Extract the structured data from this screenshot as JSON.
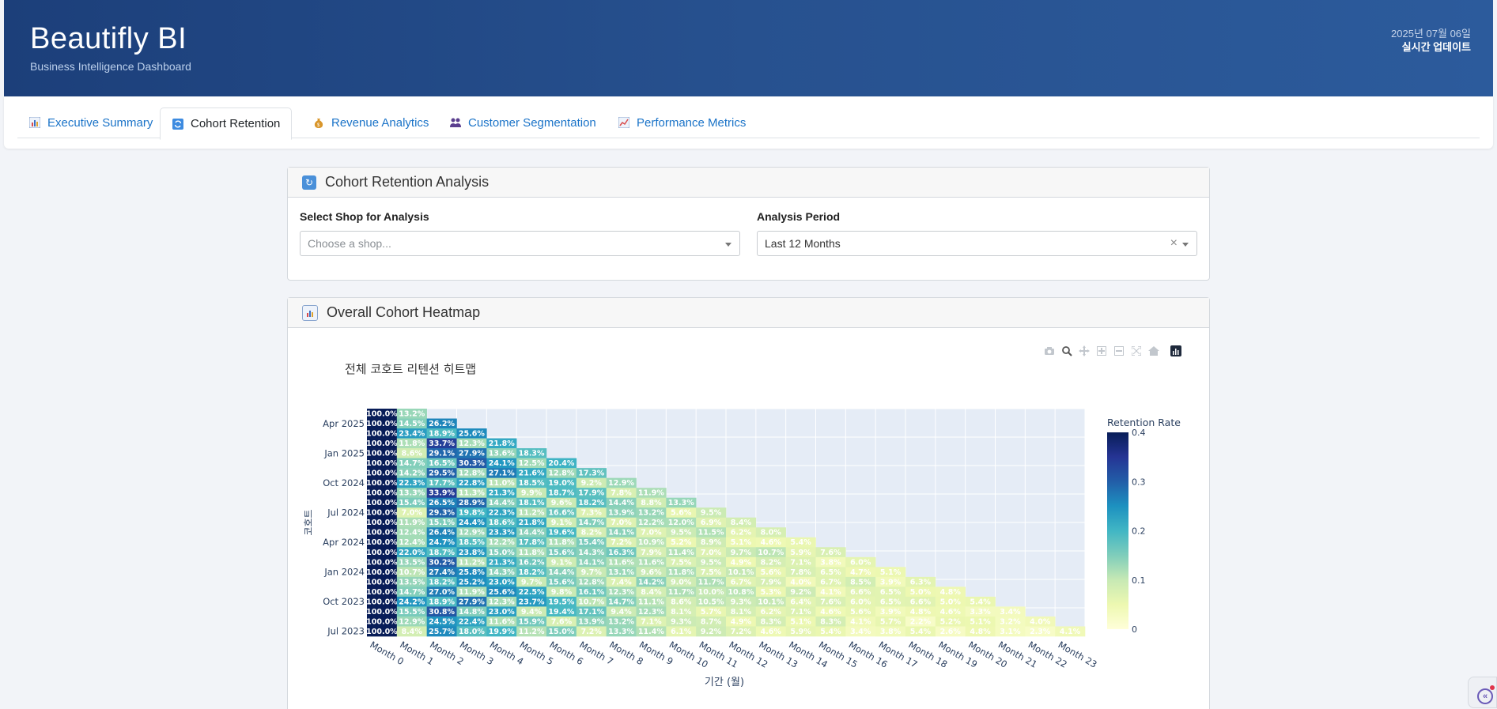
{
  "header": {
    "title": "Beautifly BI",
    "subtitle": "Business Intelligence Dashboard",
    "date": "2025년 07월 06일",
    "live": "실시간 업데이트"
  },
  "tabs": [
    {
      "label": "Executive Summary",
      "icon": "bar-chart-icon",
      "active": false
    },
    {
      "label": "Cohort Retention",
      "icon": "refresh-icon",
      "active": true
    },
    {
      "label": "Revenue Analytics",
      "icon": "money-bag-icon",
      "active": false
    },
    {
      "label": "Customer Segmentation",
      "icon": "people-icon",
      "active": false
    },
    {
      "label": "Performance Metrics",
      "icon": "line-chart-icon",
      "active": false
    }
  ],
  "cohort_panel": {
    "title": "Cohort Retention Analysis",
    "shop_label": "Select Shop for Analysis",
    "shop_placeholder": "Choose a shop...",
    "period_label": "Analysis Period",
    "period_value": "Last 12 Months"
  },
  "heatmap_panel": {
    "title": "Overall Cohort Heatmap"
  },
  "modebar": [
    "camera-icon",
    "zoom-icon",
    "pan-icon",
    "zoom-in-icon",
    "zoom-out-icon",
    "autoscale-icon",
    "reset-axes-icon",
    "plotly-logo-icon"
  ],
  "chart_data": {
    "type": "heatmap",
    "title": "전체 코호트 리텐션 히트맵",
    "xlabel": "기간 (월)",
    "ylabel": "코호트",
    "colorbar_title": "Retention Rate",
    "colorbar_ticks": [
      "0.4",
      "0.3",
      "0.2",
      "0.1",
      "0"
    ],
    "zmin": 0,
    "zmax": 0.4,
    "colorscale": [
      "#ffffd9",
      "#edf8b1",
      "#c7e9b4",
      "#7fcdbb",
      "#41b6c4",
      "#1d91c0",
      "#225ea8",
      "#253494",
      "#081d58"
    ],
    "x": [
      "Month 0",
      "Month 1",
      "Month 2",
      "Month 3",
      "Month 4",
      "Month 5",
      "Month 6",
      "Month 7",
      "Month 8",
      "Month 9",
      "Month 10",
      "Month 11",
      "Month 12",
      "Month 13",
      "Month 14",
      "Month 15",
      "Month 16",
      "Month 17",
      "Month 18",
      "Month 19",
      "Month 20",
      "Month 21",
      "Month 22",
      "Month 23"
    ],
    "y_ticks": [
      "Apr 2025",
      "Jan 2025",
      "Oct 2024",
      "Jul 2024",
      "Apr 2024",
      "Jan 2024",
      "Oct 2023",
      "Jul 2023"
    ],
    "cohorts": [
      [
        "100.0%",
        "13.2%"
      ],
      [
        "100.0%",
        "14.5%",
        "26.2%"
      ],
      [
        "100.0%",
        "23.4%",
        "18.9%",
        "25.6%"
      ],
      [
        "100.0%",
        "11.8%",
        "33.7%",
        "12.3%",
        "21.8%"
      ],
      [
        "100.0%",
        "8.6%",
        "29.1%",
        "27.9%",
        "13.6%",
        "18.3%"
      ],
      [
        "100.0%",
        "14.7%",
        "16.5%",
        "30.3%",
        "24.1%",
        "12.5%",
        "20.4%"
      ],
      [
        "100.0%",
        "14.2%",
        "29.5%",
        "12.8%",
        "27.1%",
        "21.6%",
        "12.8%",
        "17.3%"
      ],
      [
        "100.0%",
        "22.3%",
        "17.7%",
        "22.8%",
        "11.0%",
        "18.5%",
        "19.0%",
        "9.2%",
        "12.9%"
      ],
      [
        "100.0%",
        "13.3%",
        "33.9%",
        "11.3%",
        "21.3%",
        "9.9%",
        "18.7%",
        "17.9%",
        "7.8%",
        "11.9%"
      ],
      [
        "100.0%",
        "15.4%",
        "26.5%",
        "28.9%",
        "14.4%",
        "18.1%",
        "9.6%",
        "18.2%",
        "14.4%",
        "8.8%",
        "13.3%"
      ],
      [
        "100.0%",
        "7.0%",
        "29.3%",
        "19.8%",
        "22.3%",
        "11.2%",
        "16.6%",
        "7.3%",
        "13.9%",
        "13.2%",
        "5.6%",
        "9.5%"
      ],
      [
        "100.0%",
        "11.9%",
        "15.1%",
        "24.4%",
        "18.6%",
        "21.8%",
        "9.1%",
        "14.7%",
        "7.0%",
        "12.2%",
        "12.0%",
        "6.9%",
        "8.4%"
      ],
      [
        "100.0%",
        "12.4%",
        "26.4%",
        "12.9%",
        "23.3%",
        "14.4%",
        "19.6%",
        "8.2%",
        "14.1%",
        "7.0%",
        "9.5%",
        "11.5%",
        "6.2%",
        "8.0%"
      ],
      [
        "100.0%",
        "12.4%",
        "24.7%",
        "18.5%",
        "12.2%",
        "17.8%",
        "11.8%",
        "15.4%",
        "7.2%",
        "10.9%",
        "5.2%",
        "8.9%",
        "5.1%",
        "4.6%",
        "5.4%"
      ],
      [
        "100.0%",
        "22.0%",
        "18.7%",
        "23.8%",
        "15.0%",
        "11.8%",
        "15.6%",
        "14.3%",
        "16.3%",
        "7.9%",
        "11.4%",
        "7.0%",
        "9.7%",
        "10.7%",
        "5.9%",
        "7.6%"
      ],
      [
        "100.0%",
        "13.5%",
        "30.2%",
        "11.2%",
        "21.3%",
        "16.2%",
        "9.1%",
        "14.1%",
        "11.6%",
        "11.6%",
        "7.5%",
        "9.5%",
        "4.9%",
        "8.2%",
        "7.1%",
        "3.8%",
        "6.0%"
      ],
      [
        "100.0%",
        "10.7%",
        "27.4%",
        "25.8%",
        "14.3%",
        "18.2%",
        "14.4%",
        "9.7%",
        "13.1%",
        "9.6%",
        "11.8%",
        "7.5%",
        "10.1%",
        "5.6%",
        "7.8%",
        "6.5%",
        "4.7%",
        "5.1%"
      ],
      [
        "100.0%",
        "13.5%",
        "18.2%",
        "25.2%",
        "23.0%",
        "9.7%",
        "15.6%",
        "12.8%",
        "7.4%",
        "14.2%",
        "9.0%",
        "11.7%",
        "6.7%",
        "7.9%",
        "4.0%",
        "6.7%",
        "8.5%",
        "3.9%",
        "6.3%"
      ],
      [
        "100.0%",
        "14.7%",
        "27.0%",
        "11.9%",
        "25.6%",
        "22.5%",
        "9.8%",
        "16.1%",
        "12.3%",
        "8.4%",
        "11.7%",
        "10.0%",
        "10.8%",
        "5.3%",
        "9.2%",
        "4.1%",
        "6.6%",
        "6.5%",
        "5.0%",
        "4.8%"
      ],
      [
        "100.0%",
        "24.2%",
        "18.9%",
        "27.9%",
        "12.3%",
        "23.7%",
        "19.5%",
        "10.7%",
        "14.7%",
        "11.1%",
        "8.6%",
        "10.5%",
        "9.3%",
        "10.1%",
        "6.4%",
        "7.6%",
        "6.0%",
        "6.5%",
        "6.6%",
        "5.0%",
        "5.4%"
      ],
      [
        "100.0%",
        "15.5%",
        "30.8%",
        "14.8%",
        "23.0%",
        "9.4%",
        "19.4%",
        "17.1%",
        "9.4%",
        "12.3%",
        "8.1%",
        "5.7%",
        "8.1%",
        "6.2%",
        "7.1%",
        "4.6%",
        "5.6%",
        "3.9%",
        "4.8%",
        "4.6%",
        "3.3%",
        "3.4%"
      ],
      [
        "100.0%",
        "12.9%",
        "24.5%",
        "22.4%",
        "11.6%",
        "15.9%",
        "7.6%",
        "13.9%",
        "13.2%",
        "7.1%",
        "9.3%",
        "8.7%",
        "4.9%",
        "8.3%",
        "5.1%",
        "8.3%",
        "4.1%",
        "5.7%",
        "2.2%",
        "5.2%",
        "5.1%",
        "3.2%",
        "4.0%"
      ],
      [
        "100.0%",
        "8.4%",
        "25.7%",
        "18.0%",
        "19.9%",
        "11.2%",
        "15.0%",
        "7.2%",
        "13.3%",
        "11.4%",
        "6.1%",
        "9.2%",
        "7.2%",
        "4.6%",
        "5.9%",
        "5.4%",
        "3.4%",
        "3.8%",
        "5.4%",
        "2.6%",
        "4.8%",
        "3.1%",
        "2.3%",
        "4.1%"
      ]
    ]
  }
}
